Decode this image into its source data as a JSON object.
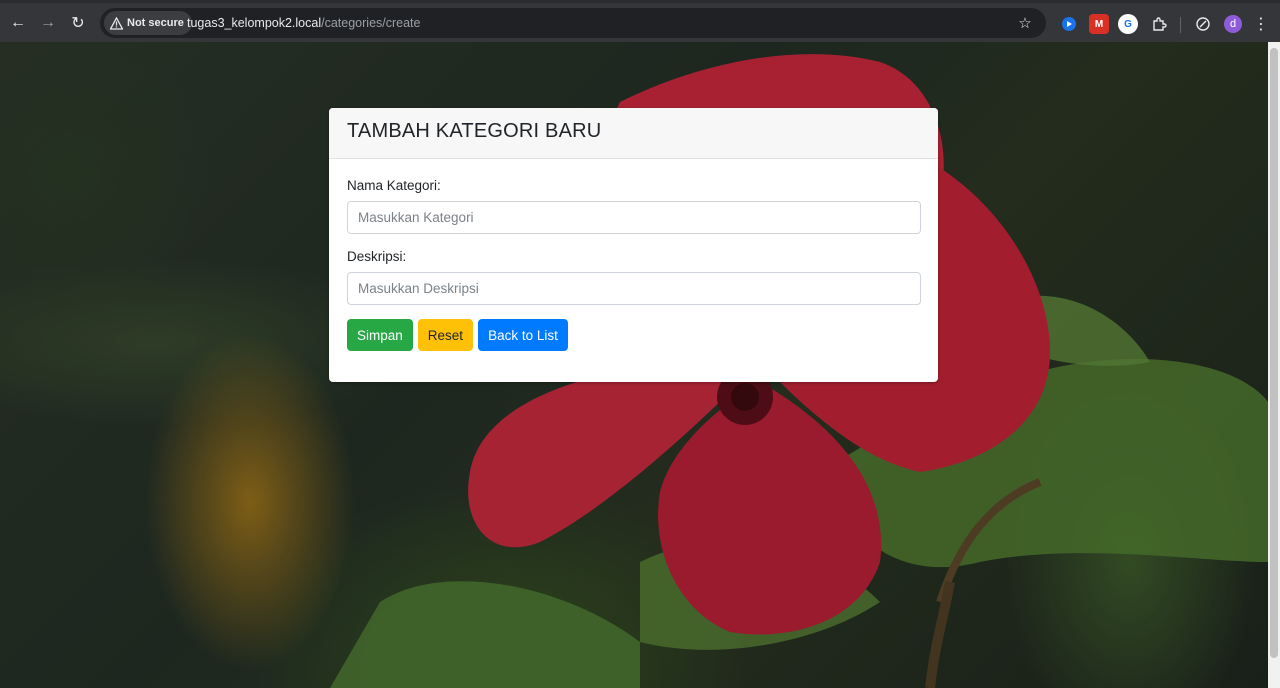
{
  "browser": {
    "security_label": "Not secure",
    "url_host": "tugas3_kelompok2.local",
    "url_path": "/categories/create",
    "profile_initial": "d",
    "icons": {
      "back": "arrow-left-icon",
      "forward": "arrow-right-icon",
      "reload": "reload-icon",
      "bookmark": "star-icon",
      "extensions": [
        "blue-circle-extension-icon",
        "red-m-extension-icon",
        "translate-extension-icon",
        "puzzle-extensions-icon",
        "leaf-extension-icon"
      ],
      "menu": "kebab-menu-icon"
    }
  },
  "form": {
    "title": "TAMBAH KATEGORI BARU",
    "name_label": "Nama Kategori:",
    "name_placeholder": "Masukkan Kategori",
    "desc_label": "Deskripsi:",
    "desc_placeholder": "Masukkan Deskripsi",
    "buttons": {
      "save": "Simpan",
      "reset": "Reset",
      "back": "Back to List"
    }
  },
  "colors": {
    "success": "#28a745",
    "warning": "#ffc107",
    "primary": "#007bff",
    "chrome_bg": "#35363a"
  }
}
